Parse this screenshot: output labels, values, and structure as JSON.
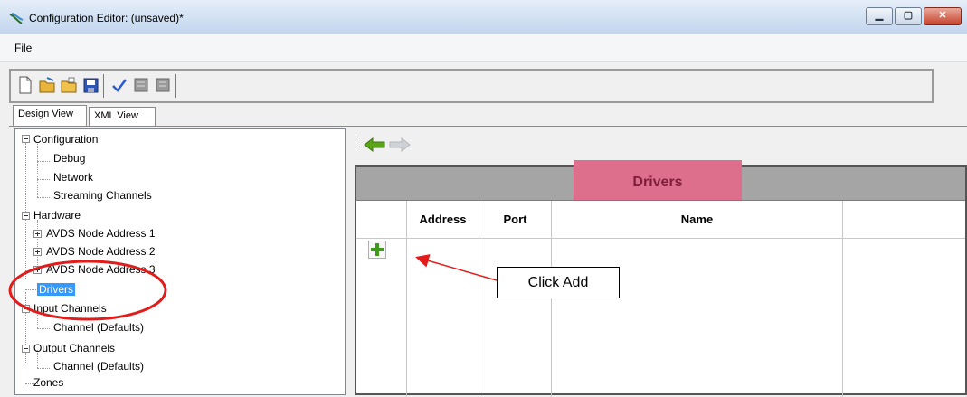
{
  "window": {
    "title": "Configuration Editor: (unsaved)*",
    "controls": [
      "minimize",
      "maximize",
      "close"
    ]
  },
  "menu": {
    "file": "File"
  },
  "toolbar": {
    "buttons": [
      "new-file-icon",
      "open-folder-icon",
      "open-icon",
      "save-icon",
      "check-icon",
      "tool-icon",
      "tool-icon"
    ]
  },
  "tabs": {
    "design_view": "Design View",
    "xml_view": "XML View"
  },
  "tree": {
    "configuration": "Configuration",
    "debug": "Debug",
    "network": "Network",
    "streaming_channels": "Streaming Channels",
    "hardware": "Hardware",
    "avds1": "AVDS Node Address 1",
    "avds2": "AVDS Node Address 2",
    "avds3": "AVDS Node Address 3",
    "drivers": "Drivers",
    "input_channels": "Input Channels",
    "input_channel_defaults": "Channel  (Defaults)",
    "output_channels": "Output Channels",
    "output_channel_defaults": "Channel  (Defaults)",
    "zones": "Zones"
  },
  "grid": {
    "title": "Drivers",
    "columns": [
      "",
      "Address",
      "Port",
      "Name",
      ""
    ]
  },
  "annotation": {
    "callout": "Click Add"
  },
  "colors": {
    "highlight": "#dd6f8c",
    "annotation_red": "#e21b1b",
    "selection": "#3399ff",
    "nav_arrow": "#4f9a12"
  }
}
